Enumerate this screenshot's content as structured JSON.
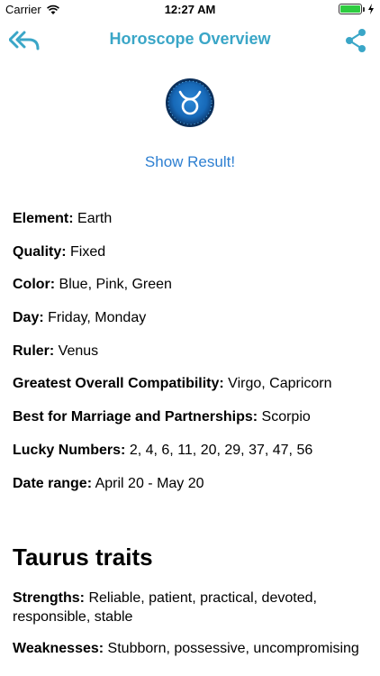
{
  "status_bar": {
    "carrier": "Carrier",
    "time": "12:27 AM"
  },
  "nav": {
    "title": "Horoscope Overview",
    "back_icon": "double-back-arrow-icon",
    "share_icon": "share-icon",
    "accent_color": "#3aa6c7"
  },
  "sign": {
    "icon": "taurus-zodiac-icon",
    "show_result_label": "Show Result!"
  },
  "info": [
    {
      "label": "Element:",
      "value": " Earth"
    },
    {
      "label": "Quality:",
      "value": " Fixed"
    },
    {
      "label": "Color:",
      "value": " Blue, Pink, Green"
    },
    {
      "label": "Day:",
      "value": " Friday, Monday"
    },
    {
      "label": "Ruler:",
      "value": " Venus"
    },
    {
      "label": "Greatest Overall Compatibility:",
      "value": " Virgo, Capricorn"
    },
    {
      "label": "Best for Marriage and Partnerships:",
      "value": " Scorpio"
    },
    {
      "label": "Lucky Numbers:",
      "value": " 2, 4, 6, 11, 20, 29, 37, 47, 56"
    },
    {
      "label": "Date range:",
      "value": " April 20 - May 20"
    }
  ],
  "traits": {
    "title": "Taurus traits",
    "items": [
      {
        "label": "Strengths:",
        "value": " Reliable, patient, practical, devoted, responsible, stable"
      },
      {
        "label": "Weaknesses:",
        "value": " Stubborn, possessive, uncompromising"
      }
    ]
  }
}
